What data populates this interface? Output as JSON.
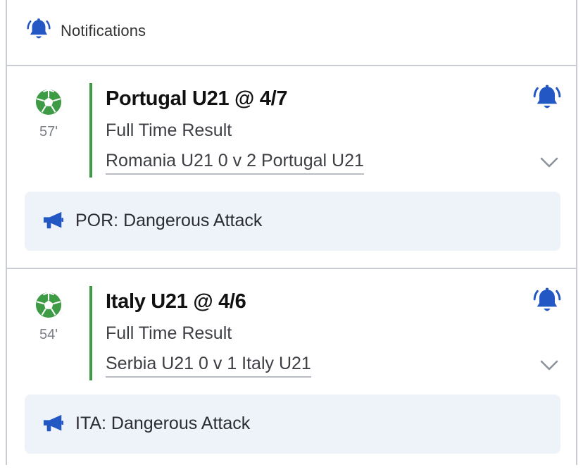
{
  "header": {
    "title": "Notifications",
    "icon": "bell-icon"
  },
  "colors": {
    "accent_blue": "#2357c4",
    "accent_green": "#3e9b45",
    "alert_bg": "#eef2f9"
  },
  "cards": [
    {
      "sport_icon": "football-icon",
      "minute": "57'",
      "selection": "Portugal U21 @ 4/7",
      "market": "Full Time Result",
      "event": "Romania U21 0 v 2 Portugal U21",
      "alert_icon": "megaphone-icon",
      "alert_text": "POR: Dangerous Attack"
    },
    {
      "sport_icon": "football-icon",
      "minute": "54'",
      "selection": "Italy U21 @ 4/6",
      "market": "Full Time Result",
      "event": "Serbia U21 0 v 1 Italy U21",
      "alert_icon": "megaphone-icon",
      "alert_text": "ITA: Dangerous Attack"
    }
  ]
}
